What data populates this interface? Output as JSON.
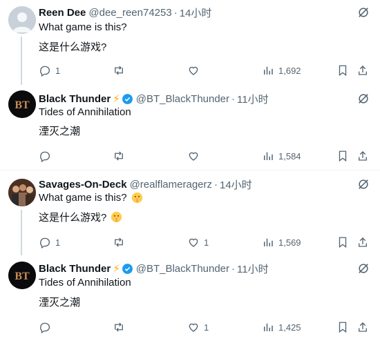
{
  "tweets": [
    {
      "name": "Reen Dee",
      "handle": "@dee_reen74253",
      "time": "14小时",
      "line1": "What game is this?",
      "line2": "这是什么游戏?",
      "replies": "1",
      "retweets": "",
      "likes": "",
      "views": "1,692"
    },
    {
      "name": "Black Thunder",
      "handle": "@BT_BlackThunder",
      "time": "11小时",
      "line1": "Tides of Annihilation",
      "line2": "湮灭之潮",
      "replies": "",
      "retweets": "",
      "likes": "",
      "views": "1,584"
    },
    {
      "name": "Savages-On-Deck",
      "handle": "@realflameragerz",
      "time": "14小时",
      "line1": "What game is this?",
      "line2": "这是什么游戏?",
      "replies": "1",
      "retweets": "",
      "likes": "1",
      "views": "1,569"
    },
    {
      "name": "Black Thunder",
      "handle": "@BT_BlackThunder",
      "time": "11小时",
      "line1": "Tides of Annihilation",
      "line2": "湮灭之潮",
      "replies": "",
      "retweets": "",
      "likes": "1",
      "views": "1,425"
    }
  ],
  "avatar_bt_text": "BT",
  "separator": "·",
  "colors": {
    "text": "#0f1419",
    "muted": "#536471",
    "verified": "#1d9bf0",
    "bolt": "#f6b100",
    "thread_line": "#cfd9de",
    "divider": "#eff3f4"
  }
}
